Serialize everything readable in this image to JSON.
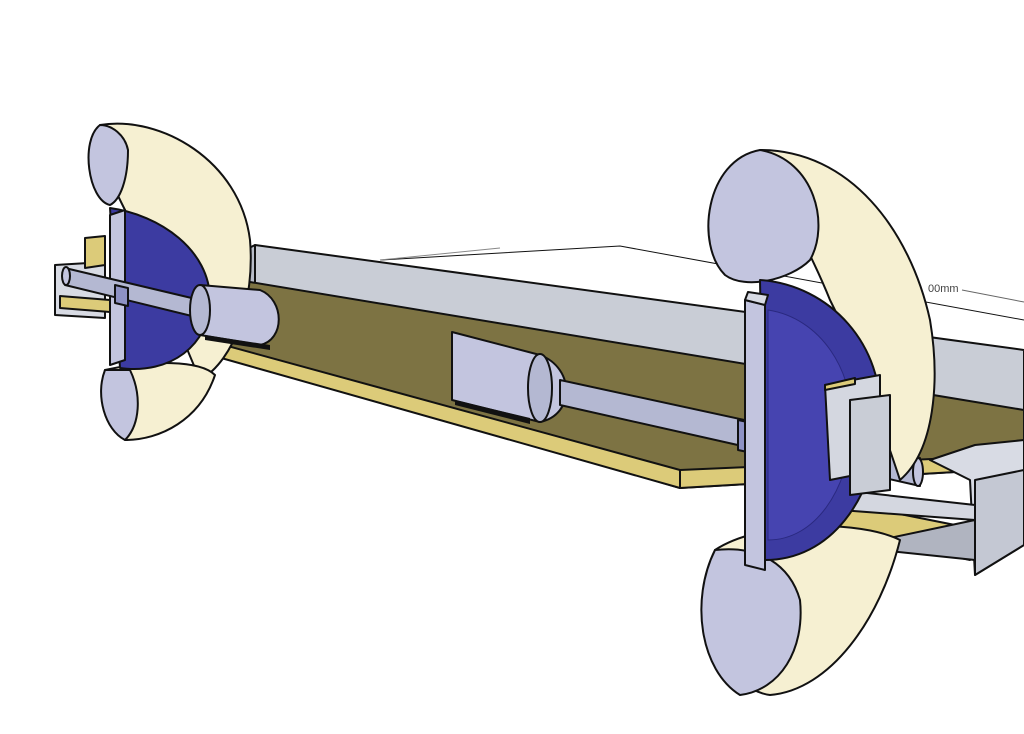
{
  "dimension": {
    "label": "00mm"
  },
  "colors": {
    "background": "#ffffff",
    "board_top": "#7d7343",
    "board_edge": "#dccb79",
    "gray_box": "#c9cdd6",
    "tire_outer": "#f6f0d2",
    "tire_inner": "#c3c5df",
    "hub_blue": "#3c3ba1",
    "axle": "#b4b8d2",
    "outline": "#111111"
  }
}
